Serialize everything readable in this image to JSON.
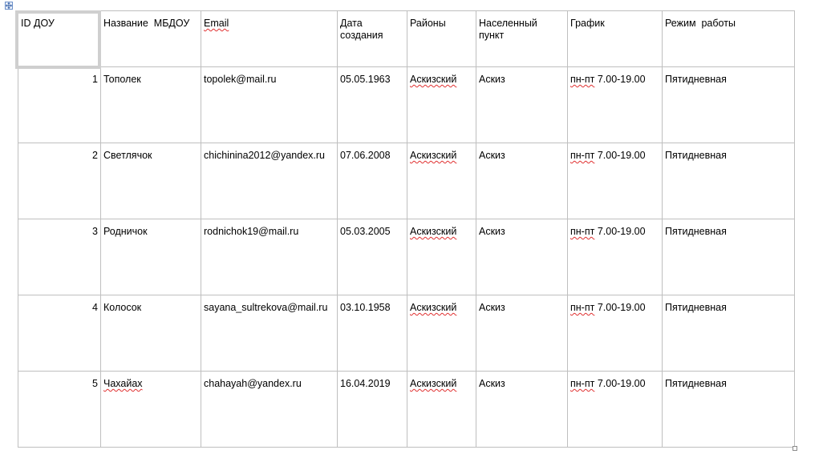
{
  "table": {
    "headers": {
      "id": "ID ДОУ",
      "name": "Название  МБДОУ",
      "email": "Email",
      "date_line1": "Дата",
      "date_line2": "создания",
      "district": "Районы",
      "locality_line1": "Населенный",
      "locality_line2": "пункт",
      "schedule": "График",
      "mode": "Режим  работы"
    },
    "rows": [
      {
        "id": "1",
        "name": "Тополек",
        "email": "topolek@mail.ru",
        "date": "05.05.1963",
        "district": "Аскизский",
        "locality": "Аскиз",
        "schedule_days": "пн-пт",
        "schedule_hours": " 7.00-19.00",
        "mode": "Пятидневная"
      },
      {
        "id": "2",
        "name": "Светлячок",
        "email": "chichinina2012@yandex.ru",
        "date": "07.06.2008",
        "district": "Аскизский",
        "locality": "Аскиз",
        "schedule_days": "пн-пт",
        "schedule_hours": " 7.00-19.00",
        "mode": "Пятидневная"
      },
      {
        "id": "3",
        "name": "Родничок",
        "email": "rodnichok19@mail.ru",
        "date": "05.03.2005",
        "district": "Аскизский",
        "locality": "Аскиз",
        "schedule_days": "пн-пт",
        "schedule_hours": " 7.00-19.00",
        "mode": "Пятидневная"
      },
      {
        "id": "4",
        "name": "Колосок",
        "email": "sayana_sultrekova@mail.ru",
        "date": "03.10.1958",
        "district": "Аскизский",
        "locality": "Аскиз",
        "schedule_days": "пн-пт",
        "schedule_hours": " 7.00-19.00",
        "mode": "Пятидневная"
      },
      {
        "id": "5",
        "name": "Чахайах",
        "email": "chahayah@yandex.ru",
        "date": "16.04.2019",
        "district": "Аскизский",
        "locality": "Аскиз",
        "schedule_days": "пн-пт",
        "schedule_hours": " 7.00-19.00",
        "mode": "Пятидневная"
      }
    ]
  },
  "icons": {
    "move_handle": "move-arrows-icon",
    "resize_handle": "resize-square-icon"
  },
  "colors": {
    "grid": "#bfbfbf",
    "spellcheck": "#e03030",
    "selection": "#cfcfcf"
  }
}
